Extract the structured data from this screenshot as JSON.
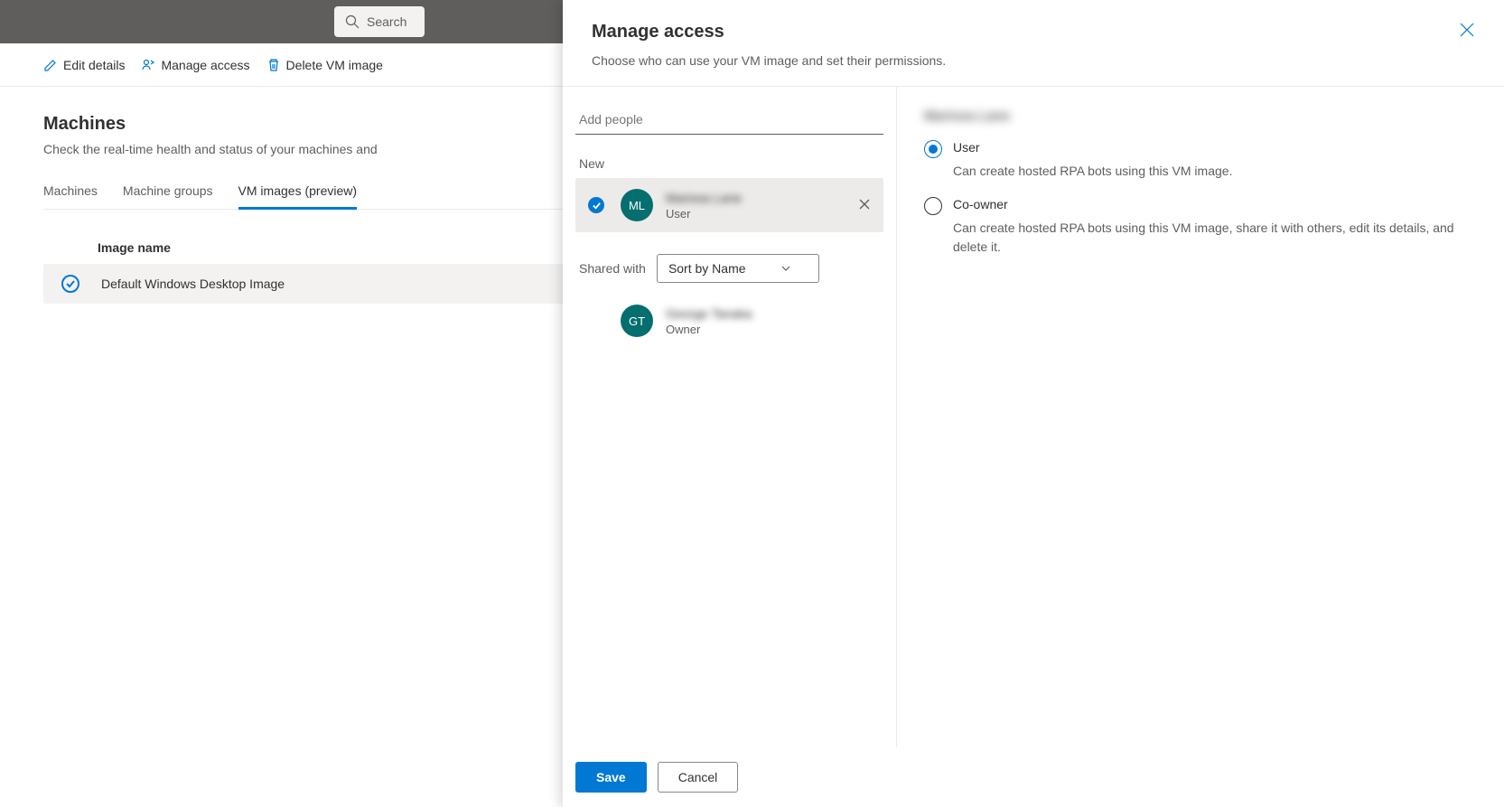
{
  "search": {
    "placeholder": "Search"
  },
  "commandBar": {
    "edit": "Edit details",
    "manage": "Manage access",
    "delete": "Delete VM image"
  },
  "page": {
    "title": "Machines",
    "subtitle": "Check the real-time health and status of your machines and"
  },
  "tabs": {
    "t1": "Machines",
    "t2": "Machine groups",
    "t3": "VM images (preview)"
  },
  "table": {
    "header": "Image name",
    "row1": "Default Windows Desktop Image"
  },
  "panel": {
    "title": "Manage access",
    "subtitle": "Choose who can use your VM image and set their permissions.",
    "addPeople": "Add people",
    "newLabel": "New",
    "sharedWith": "Shared with",
    "sortBy": "Sort by Name",
    "person1": {
      "initials": "ML",
      "name": "Marissa Lane",
      "role": "User"
    },
    "person2": {
      "initials": "GT",
      "name": "George Tanaka",
      "role": "Owner"
    },
    "rightName": "Marissa Lane",
    "roleUser": {
      "label": "User",
      "desc": "Can create hosted RPA bots using this VM image."
    },
    "roleCoowner": {
      "label": "Co-owner",
      "desc": "Can create hosted RPA bots using this VM image, share it with others, edit its details, and delete it."
    },
    "save": "Save",
    "cancel": "Cancel"
  }
}
